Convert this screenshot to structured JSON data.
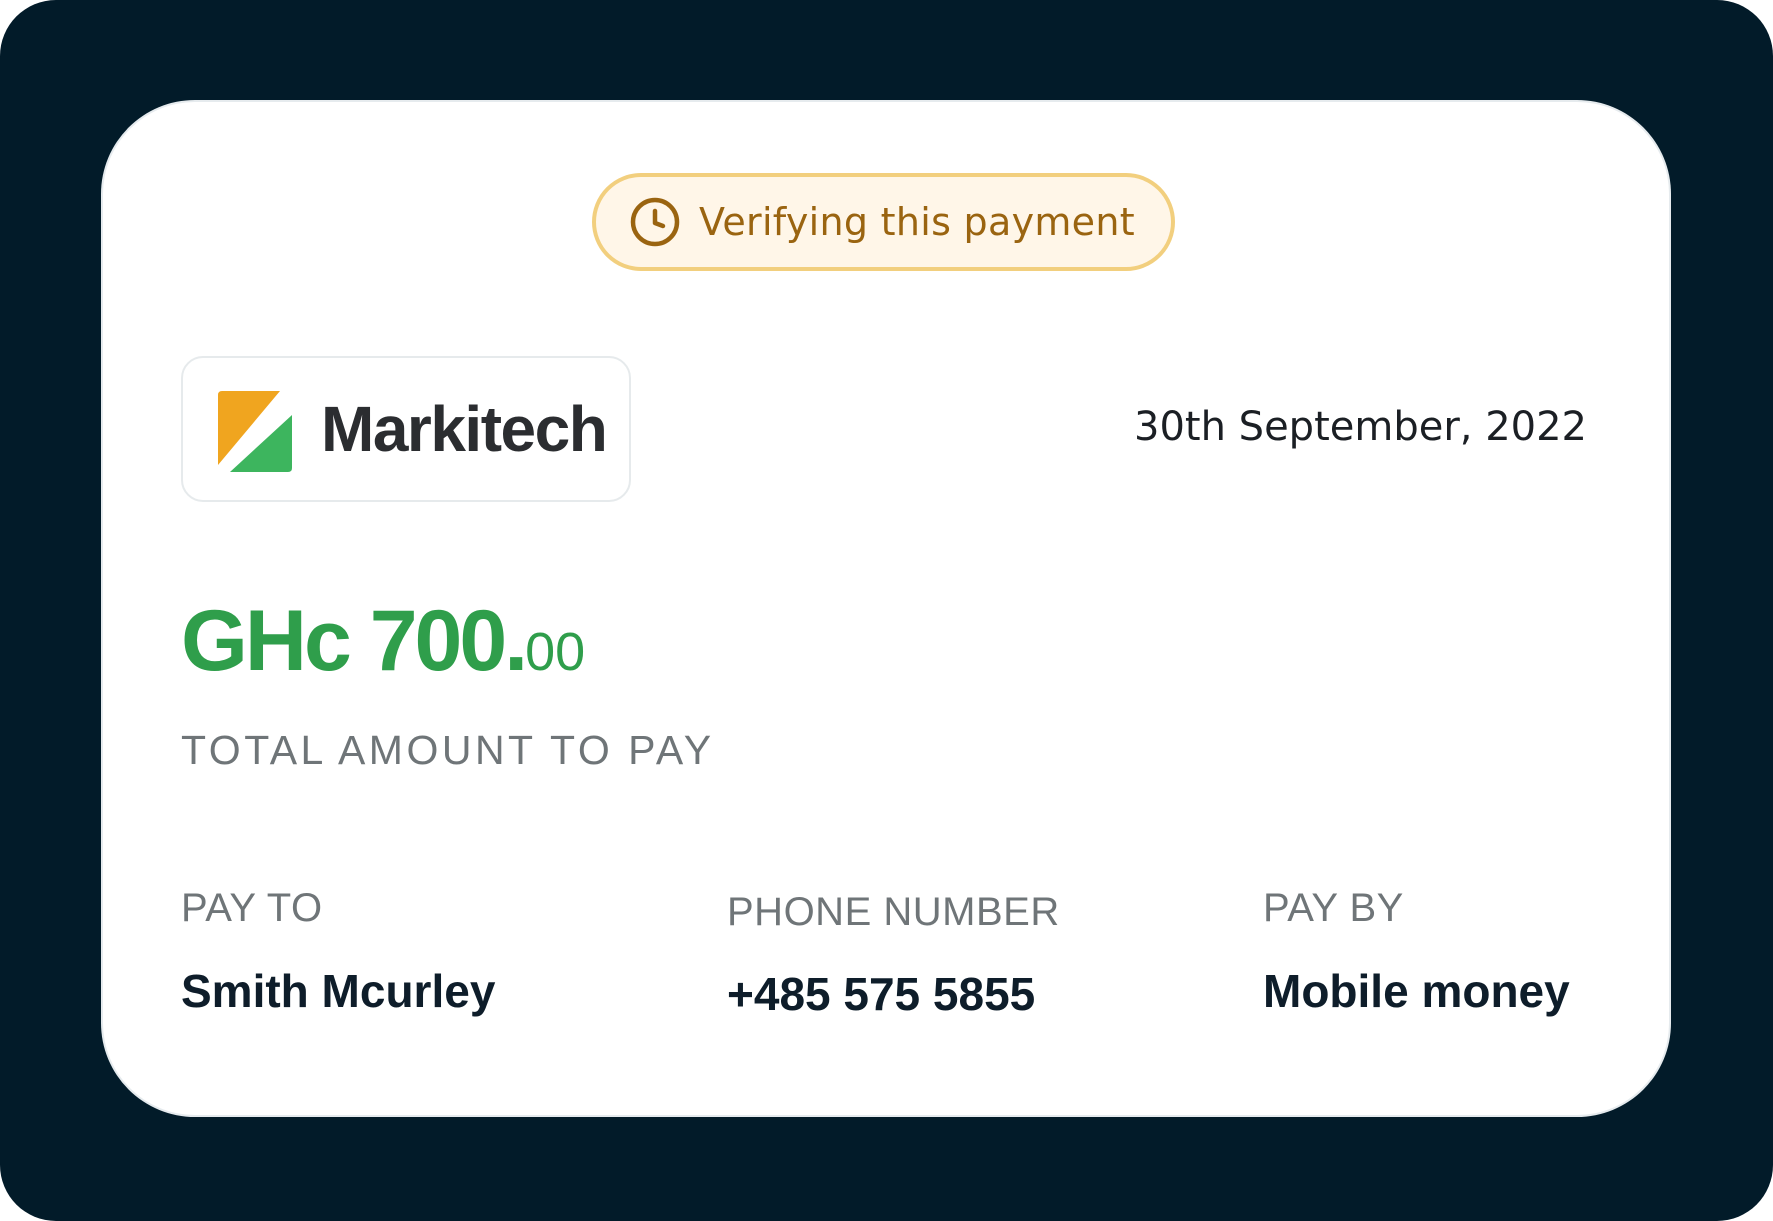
{
  "status": {
    "text": "Verifying this payment",
    "icon": "clock-icon",
    "color": "#9a6410",
    "background": "#fff6e8",
    "border": "#f2cf7e"
  },
  "brand": {
    "name": "Markitech",
    "logo_colors": [
      "#f0a51f",
      "#3db55e"
    ]
  },
  "date": "30th September, 2022",
  "amount": {
    "whole": "GHc 700.",
    "cents": "00",
    "label": "TOTAL AMOUNT TO PAY",
    "color": "#2f9e4b"
  },
  "details": {
    "pay_to": {
      "label": "PAY TO",
      "value": "Smith Mcurley"
    },
    "phone": {
      "label": "PHONE NUMBER",
      "value": "+485 575 5855"
    },
    "pay_by": {
      "label": "PAY BY",
      "value": "Mobile money"
    }
  },
  "theme": {
    "frame_background": "#021b29",
    "card_background": "#ffffff"
  }
}
